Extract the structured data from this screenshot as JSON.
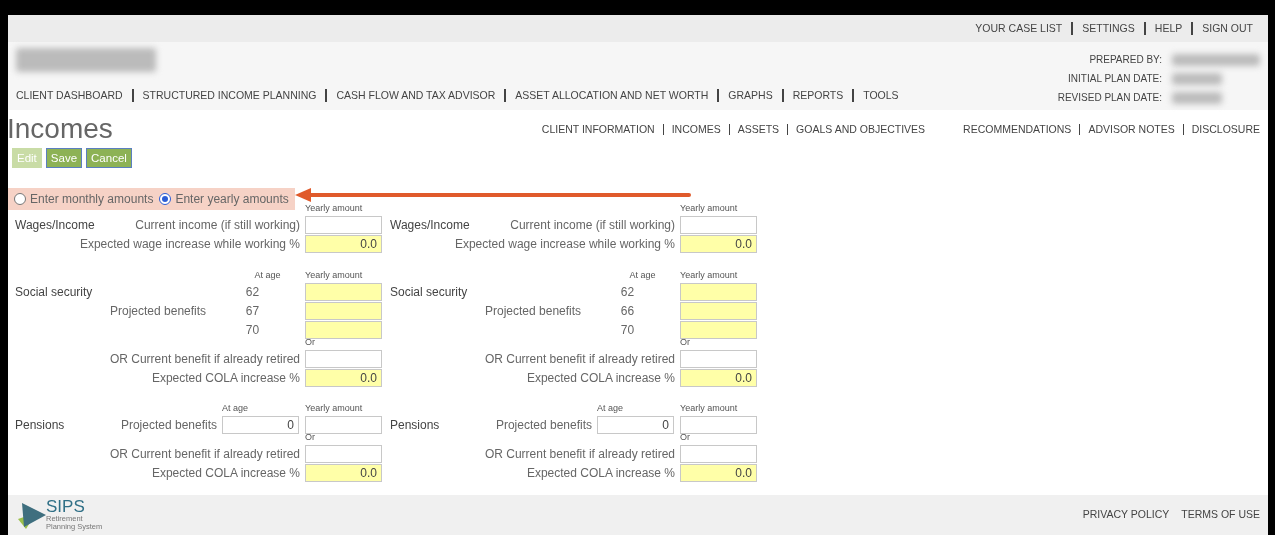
{
  "top_links": [
    "YOUR CASE LIST",
    "SETTINGS",
    "HELP",
    "SIGN OUT"
  ],
  "plan_info": [
    "PREPARED BY:",
    "INITIAL PLAN DATE:",
    "REVISED PLAN DATE:"
  ],
  "main_nav": [
    "CLIENT DASHBOARD",
    "STRUCTURED INCOME PLANNING",
    "CASH FLOW AND TAX ADVISOR",
    "ASSET ALLOCATION AND NET WORTH",
    "GRAPHS",
    "REPORTS",
    "TOOLS"
  ],
  "page_title": "Incomes",
  "sub_nav_left": [
    "CLIENT INFORMATION",
    "INCOMES",
    "ASSETS",
    "GOALS AND OBJECTIVES"
  ],
  "sub_nav_right": [
    "RECOMMENDATIONS",
    "ADVISOR NOTES",
    "DISCLOSURE"
  ],
  "buttons": [
    {
      "label": "Edit",
      "disabled": true
    },
    {
      "label": "Save",
      "disabled": false
    },
    {
      "label": "Cancel",
      "disabled": false
    }
  ],
  "amount_mode": [
    {
      "label": "Enter monthly amounts",
      "selected": false
    },
    {
      "label": "Enter yearly amounts",
      "selected": true
    }
  ],
  "columns": [
    {
      "wages": {
        "title": "Wages/Income",
        "amount_header": "Yearly amount",
        "rows": [
          {
            "label": "Current income (if still working)",
            "input": {
              "highlighted": false
            }
          },
          {
            "label": "Expected wage increase while working %",
            "input": {
              "value": "0.0",
              "highlighted": true
            }
          }
        ]
      },
      "social_security": {
        "title": "Social security",
        "age_header": "At age",
        "amount_header": "Yearly amount",
        "benefits_label": "Projected benefits",
        "ages": [
          {
            "age": "62",
            "input": {
              "highlighted": true
            }
          },
          {
            "age": "67",
            "input": {
              "highlighted": true
            }
          },
          {
            "age": "70",
            "input": {
              "highlighted": true
            }
          }
        ],
        "or_label": "Or",
        "rows": [
          {
            "label": "OR Current benefit if already retired",
            "input": {
              "highlighted": false
            }
          },
          {
            "label": "Expected COLA increase %",
            "input": {
              "value": "0.0",
              "highlighted": true
            }
          }
        ]
      },
      "pensions": {
        "title": "Pensions",
        "age_header": "At age",
        "amount_header": "Yearly amount",
        "benefits_label": "Projected benefits",
        "age_input": {
          "value": "0",
          "highlighted": false
        },
        "amount_input": {
          "highlighted": false
        },
        "or_label": "Or",
        "rows": [
          {
            "label": "OR Current benefit if already retired",
            "input": {
              "highlighted": false
            }
          },
          {
            "label": "Expected COLA increase %",
            "input": {
              "value": "0.0",
              "highlighted": true
            }
          }
        ]
      }
    },
    {
      "wages": {
        "title": "Wages/Income",
        "amount_header": "Yearly amount",
        "rows": [
          {
            "label": "Current income (if still working)",
            "input": {
              "highlighted": false
            }
          },
          {
            "label": "Expected wage increase while working %",
            "input": {
              "value": "0.0",
              "highlighted": true
            }
          }
        ]
      },
      "social_security": {
        "title": "Social security",
        "age_header": "At age",
        "amount_header": "Yearly amount",
        "benefits_label": "Projected benefits",
        "ages": [
          {
            "age": "62",
            "input": {
              "highlighted": true
            }
          },
          {
            "age": "66",
            "input": {
              "highlighted": true
            }
          },
          {
            "age": "70",
            "input": {
              "highlighted": true
            }
          }
        ],
        "or_label": "Or",
        "rows": [
          {
            "label": "OR Current benefit if already retired",
            "input": {
              "highlighted": false
            }
          },
          {
            "label": "Expected COLA increase %",
            "input": {
              "value": "0.0",
              "highlighted": true
            }
          }
        ]
      },
      "pensions": {
        "title": "Pensions",
        "age_header": "At age",
        "amount_header": "Yearly amount",
        "benefits_label": "Projected benefits",
        "age_input": {
          "value": "0",
          "highlighted": false
        },
        "amount_input": {
          "highlighted": false
        },
        "or_label": "Or",
        "rows": [
          {
            "label": "OR Current benefit if already retired",
            "input": {
              "highlighted": false
            }
          },
          {
            "label": "Expected COLA increase %",
            "input": {
              "value": "0.0",
              "highlighted": true
            }
          }
        ]
      }
    }
  ],
  "footer": {
    "logo_text": "SIPS",
    "logo_subtitle": [
      "Retirement",
      "Planning System"
    ],
    "links": [
      "PRIVACY POLICY",
      "TERMS OF USE"
    ]
  }
}
